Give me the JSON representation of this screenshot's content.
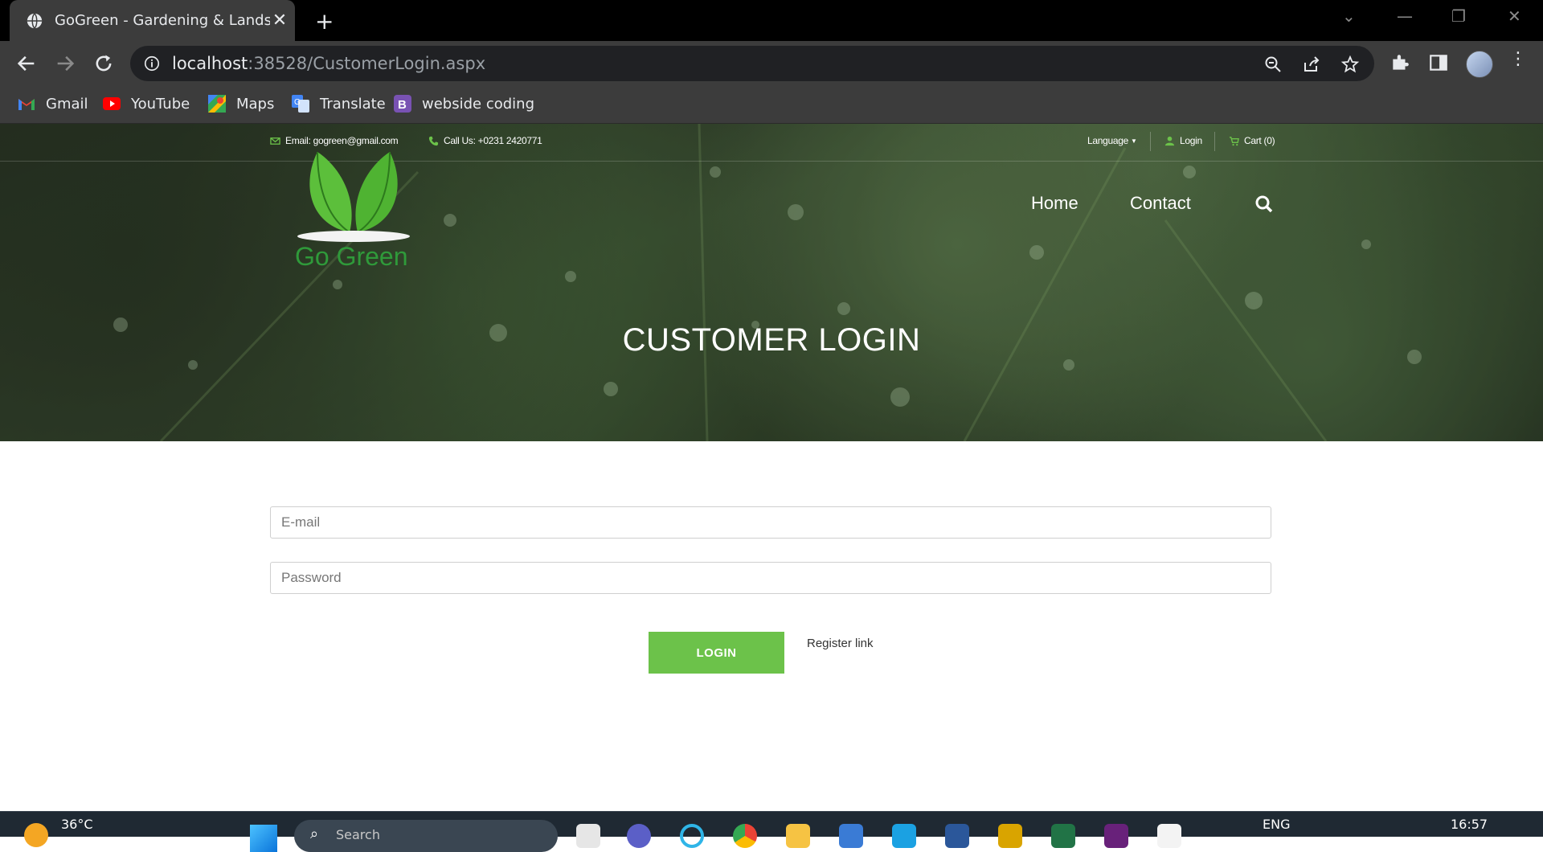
{
  "browser": {
    "tab_title": "GoGreen - Gardening & Landscaping",
    "url_host": "localhost",
    "url_rest": ":38528/CustomerLogin.aspx",
    "bookmarks": [
      "Gmail",
      "YouTube",
      "Maps",
      "Translate",
      "webside coding"
    ]
  },
  "topbar": {
    "email": "Email: gogreen@gmail.com",
    "phone": "Call Us: +0231 2420771",
    "language": "Language",
    "login": "Login",
    "cart": "Cart (0)"
  },
  "logo_text": "Go Green",
  "nav": {
    "home": "Home",
    "contact": "Contact"
  },
  "hero_title": "CUSTOMER LOGIN",
  "form": {
    "email_placeholder": "E-mail",
    "password_placeholder": "Password",
    "login_label": "LOGIN",
    "register_label": "Register link"
  },
  "taskbar": {
    "weather": "36°C",
    "search": "Search",
    "language": "ENG",
    "time": "16:57"
  },
  "colors": {
    "accent": "#6cc24a",
    "logo": "#2f9a3a"
  }
}
